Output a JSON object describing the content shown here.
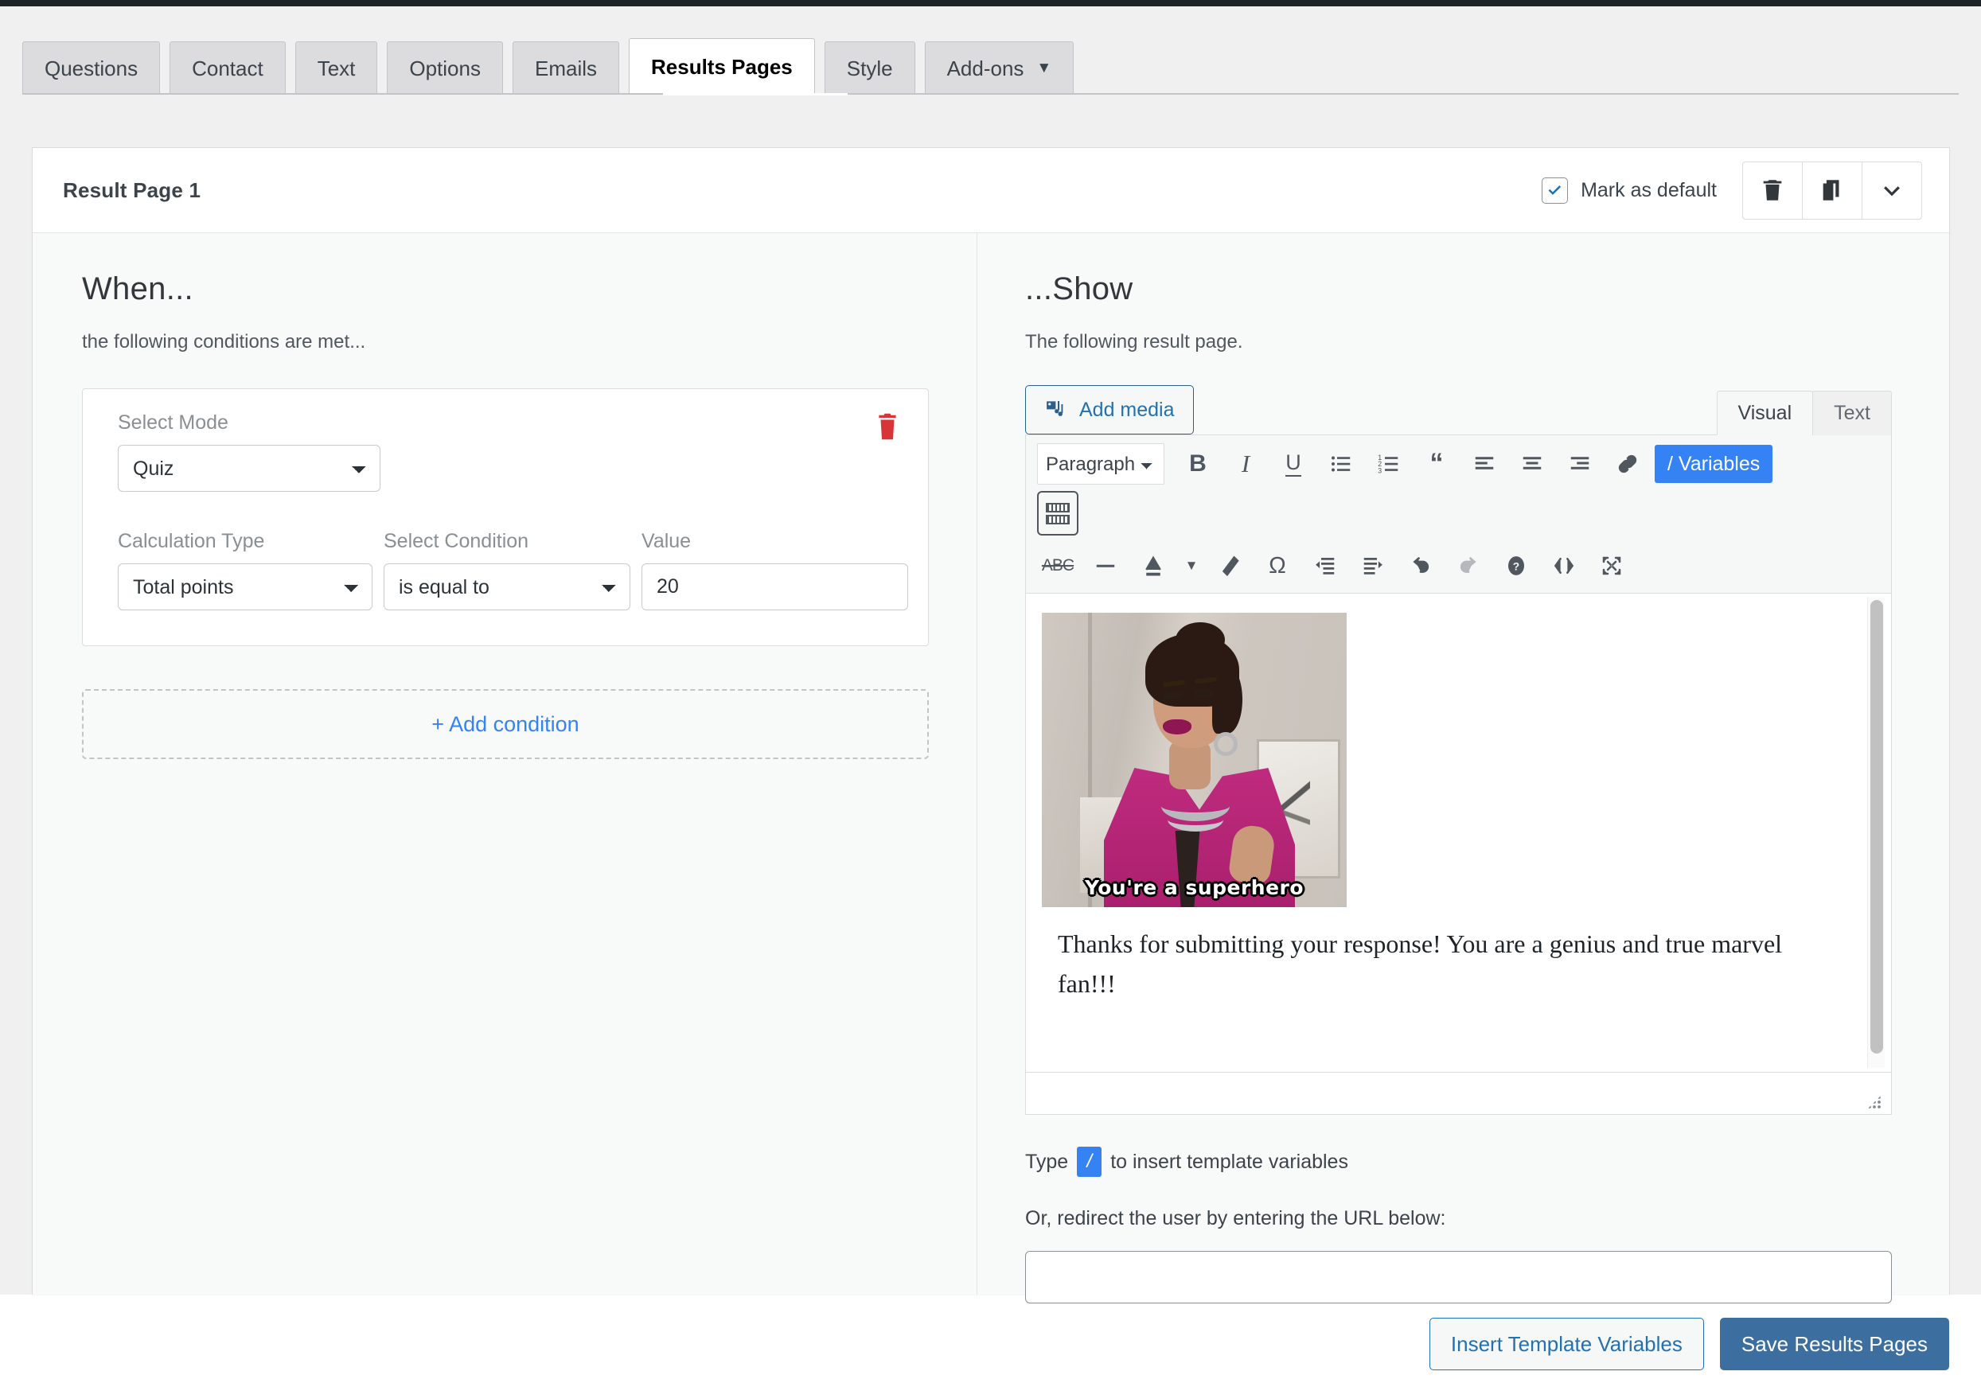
{
  "nav": {
    "tabs": [
      {
        "label": "Questions",
        "active": false,
        "caret": false
      },
      {
        "label": "Contact",
        "active": false,
        "caret": false
      },
      {
        "label": "Text",
        "active": false,
        "caret": false
      },
      {
        "label": "Options",
        "active": false,
        "caret": false
      },
      {
        "label": "Emails",
        "active": false,
        "caret": false
      },
      {
        "label": "Results Pages",
        "active": true,
        "caret": false
      },
      {
        "label": "Style",
        "active": false,
        "caret": false
      },
      {
        "label": "Add-ons",
        "active": false,
        "caret": true
      }
    ]
  },
  "card": {
    "title": "Result Page 1",
    "mark_as_default_label": "Mark as default",
    "mark_as_default_checked": true,
    "header_actions": [
      {
        "name": "delete-result-page-button",
        "icon": "trash-icon"
      },
      {
        "name": "duplicate-result-page-button",
        "icon": "copy-icon"
      },
      {
        "name": "collapse-result-page-button",
        "icon": "chevron-down-icon"
      }
    ]
  },
  "when": {
    "heading": "When...",
    "subtitle": "the following conditions are met...",
    "condition": {
      "mode_label": "Select Mode",
      "mode_value": "Quiz",
      "mode_options": [
        "Quiz"
      ],
      "calculation_label": "Calculation Type",
      "calculation_value": "Total points",
      "calculation_options": [
        "Total points"
      ],
      "condition_label": "Select Condition",
      "condition_value": "is equal to",
      "condition_options": [
        "is equal to"
      ],
      "value_label": "Value",
      "value_value": "20"
    },
    "add_condition_label": "+ Add condition"
  },
  "show": {
    "heading": "...Show",
    "subtitle": "The following result page.",
    "add_media_label": "Add media",
    "view_tabs": [
      {
        "label": "Visual",
        "active": true
      },
      {
        "label": "Text",
        "active": false
      }
    ],
    "toolbar": {
      "format_value": "Paragraph",
      "format_options": [
        "Paragraph"
      ],
      "variables_label": "/ Variables",
      "row1_icons": [
        "bold-icon",
        "italic-icon",
        "underline-icon",
        "bulleted-list-icon",
        "numbered-list-icon",
        "blockquote-icon",
        "align-left-icon",
        "align-center-icon",
        "align-right-icon",
        "insert-link-icon"
      ],
      "kitchen_sink_icon": "toolbar-toggle-icon",
      "row2_icons": [
        "strikethrough-icon",
        "horizontal-rule-icon",
        "text-color-icon",
        "text-color-dropdown-icon",
        "clear-formatting-icon",
        "special-character-icon",
        "decrease-indent-icon",
        "increase-indent-icon",
        "undo-icon",
        "redo-icon",
        "keyboard-shortcuts-icon",
        "source-code-icon",
        "fullscreen-icon"
      ]
    },
    "content": {
      "image_caption": "You're a superhero",
      "body_text": "Thanks for submitting your response! You are a genius and true marvel fan!!!"
    },
    "hint_prefix": "Type",
    "hint_slash": "/",
    "hint_suffix": "to insert template variables",
    "redirect_label": "Or, redirect the user by entering the URL below:",
    "redirect_value": "",
    "redirect_placeholder": ""
  },
  "footer": {
    "insert_label": "Insert Template Variables",
    "save_label": "Save Results Pages"
  },
  "colors": {
    "accent_blue": "#3582f5",
    "link_blue": "#2271b1",
    "primary_button": "#3c6e9f",
    "danger_red": "#d63638"
  }
}
